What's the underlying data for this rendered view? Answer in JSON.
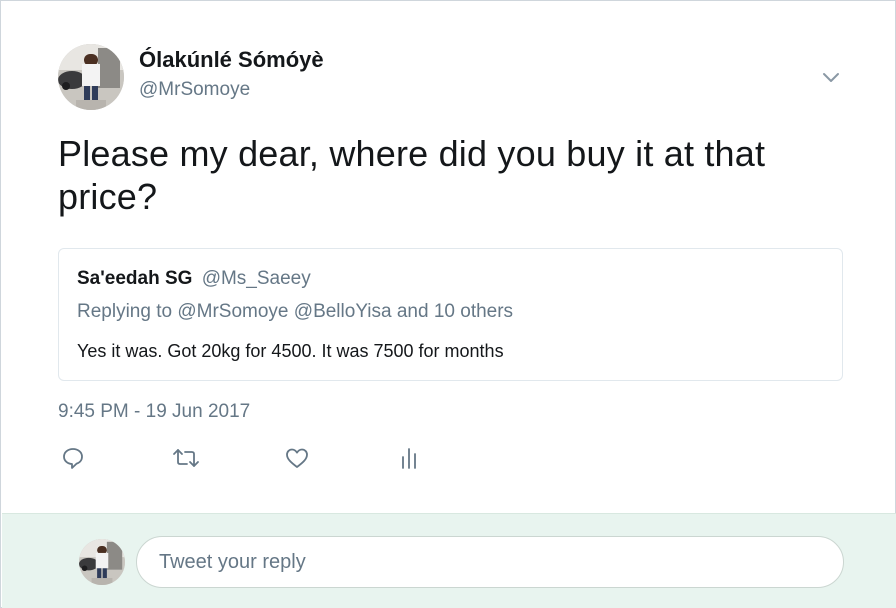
{
  "tweet": {
    "author_name": "Ólakúnlé Sómóyè",
    "author_handle": "@MrSomoye",
    "text": "Please my dear, where did you buy it at that price?",
    "timestamp": "9:45 PM - 19 Jun 2017"
  },
  "quoted_tweet": {
    "author_name": "Sa'eedah SG",
    "author_handle": "@Ms_Saeey",
    "replying_prefix": "Replying to",
    "replying_handle_1": "@MrSomoye",
    "replying_handle_2": "@BelloYisa",
    "replying_suffix": "and 10 others",
    "text": "Yes it was. Got 20kg for 4500. It was 7500 for months"
  },
  "actions": {
    "reply_icon": "speech-bubble-icon",
    "retweet_icon": "retweet-icon",
    "like_icon": "heart-icon",
    "analytics_icon": "bar-chart-icon"
  },
  "reply_box": {
    "placeholder": "Tweet your reply"
  },
  "colors": {
    "text_primary": "#14171a",
    "text_secondary": "#657786",
    "reply_bar_bg": "#e8f4ef"
  }
}
